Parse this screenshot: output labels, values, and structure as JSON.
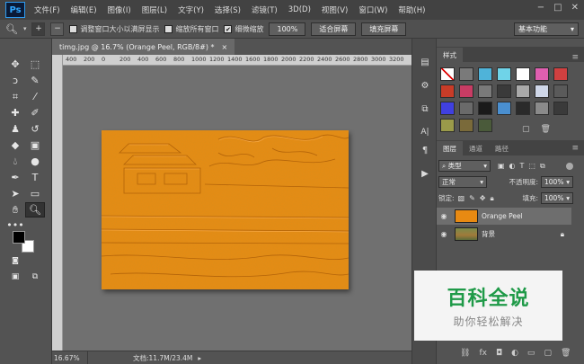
{
  "app": {
    "logo": "Ps",
    "window_controls": [
      "−",
      "□",
      "✕"
    ]
  },
  "menu": [
    "文件(F)",
    "编辑(E)",
    "图像(I)",
    "图层(L)",
    "文字(Y)",
    "选择(S)",
    "滤镜(T)",
    "3D(D)",
    "视图(V)",
    "窗口(W)",
    "帮助(H)"
  ],
  "options": {
    "resize_windows": "调整窗口大小以满屏显示",
    "zoom_all": "缩放所有窗口",
    "scrubby_zoom": "细微缩放",
    "scrubby_checked": true,
    "zoom100": "100%",
    "fit_screen": "适合屏幕",
    "fill_screen": "填充屏幕",
    "workspace": "基本功能"
  },
  "document": {
    "tab_title": "timg.jpg @ 16.7% (Orange Peel, RGB/8#) *",
    "close": "×"
  },
  "ruler_ticks": [
    "400",
    "200",
    "0",
    "200",
    "400",
    "600",
    "800",
    "1000",
    "1200",
    "1400",
    "1600",
    "1800",
    "2000",
    "2200",
    "2400",
    "2600",
    "2800",
    "3000",
    "3200"
  ],
  "status": {
    "zoom": "16.67%",
    "doc": "文档:11.7M/23.4M",
    "arrow": "▸"
  },
  "styles_panel": {
    "tab": "样式",
    "colors": [
      "#ffffff",
      "#7a7a7a",
      "#4fb3d9",
      "#6fd3e8",
      "#ffffff",
      "#e05fb0",
      "#d04040",
      "#c83c28",
      "#c83c64",
      "#7a7a7a",
      "#3a3a3a",
      "#a9a9a9",
      "#cfd7e8",
      "#5a5a5a",
      "#4040e0",
      "#6a6a6a",
      "#1a1a1a",
      "#4a8fd0",
      "#2a2a2a",
      "#8a8a8a",
      "#3a3a3a",
      "#9a9a4a",
      "#7a6a3a",
      "#4a5a3a"
    ]
  },
  "layers_panel": {
    "tabs": [
      "图层",
      "通道",
      "路径"
    ],
    "filter": "类型",
    "blend_mode": "正常",
    "opacity_label": "不透明度:",
    "opacity": "100%",
    "lock_label": "锁定:",
    "fill_label": "填充:",
    "fill": "100%",
    "layers": [
      {
        "name": "Orange Peel",
        "selected": true
      },
      {
        "name": "背景",
        "selected": false
      }
    ]
  },
  "watermark": {
    "title": "百科全说",
    "subtitle": "助你轻松解决"
  }
}
